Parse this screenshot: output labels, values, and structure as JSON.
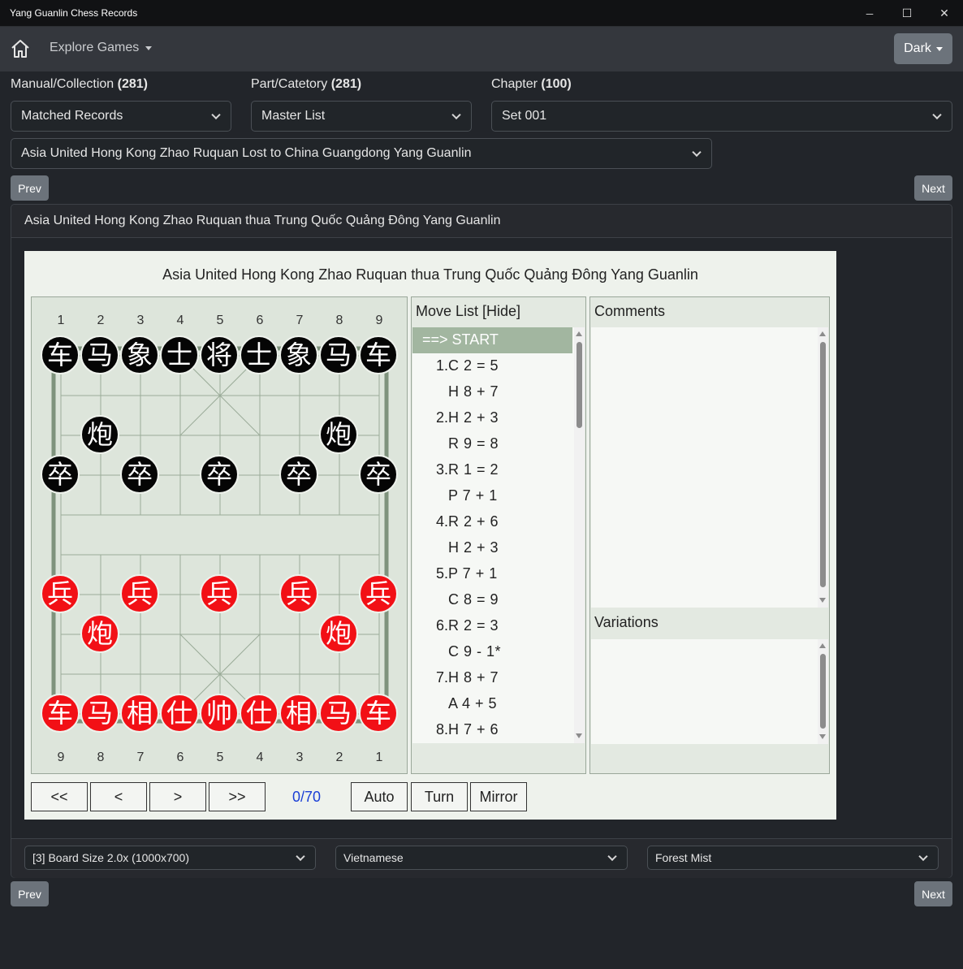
{
  "window": {
    "title": "Yang Guanlin Chess Records",
    "minimize_glyph": "─",
    "maximize_glyph": "☐",
    "close_glyph": "✕"
  },
  "navbar": {
    "home_icon": "home-icon",
    "explore_label": "Explore Games",
    "theme_label": "Dark"
  },
  "filters": {
    "manual_label": "Manual/Collection",
    "manual_count": "(281)",
    "part_label": "Part/Catetory",
    "part_count": "(281)",
    "chapter_label": "Chapter",
    "chapter_count": "(100)",
    "manual_value": "Matched Records",
    "part_value": "Master List",
    "chapter_value": "Set 001",
    "game_value": "Asia United Hong Kong Zhao Ruquan Lost to China Guangdong Yang Guanlin"
  },
  "nav": {
    "prev": "Prev",
    "next": "Next"
  },
  "card": {
    "header": "Asia United Hong Kong Zhao Ruquan thua Trung Quốc Quảng Đông Yang Guanlin"
  },
  "game": {
    "title": "Asia United Hong Kong Zhao Ruquan thua Trung Quốc Quảng Đông Yang Guanlin",
    "top_files": [
      "1",
      "2",
      "3",
      "4",
      "5",
      "6",
      "7",
      "8",
      "9"
    ],
    "bottom_files": [
      "9",
      "8",
      "7",
      "6",
      "5",
      "4",
      "3",
      "2",
      "1"
    ],
    "pieces": [
      {
        "c": 0,
        "r": 0,
        "g": "车",
        "s": "black"
      },
      {
        "c": 1,
        "r": 0,
        "g": "马",
        "s": "black"
      },
      {
        "c": 2,
        "r": 0,
        "g": "象",
        "s": "black"
      },
      {
        "c": 3,
        "r": 0,
        "g": "士",
        "s": "black"
      },
      {
        "c": 4,
        "r": 0,
        "g": "将",
        "s": "black"
      },
      {
        "c": 5,
        "r": 0,
        "g": "士",
        "s": "black"
      },
      {
        "c": 6,
        "r": 0,
        "g": "象",
        "s": "black"
      },
      {
        "c": 7,
        "r": 0,
        "g": "马",
        "s": "black"
      },
      {
        "c": 8,
        "r": 0,
        "g": "车",
        "s": "black"
      },
      {
        "c": 1,
        "r": 2,
        "g": "炮",
        "s": "black"
      },
      {
        "c": 7,
        "r": 2,
        "g": "炮",
        "s": "black"
      },
      {
        "c": 0,
        "r": 3,
        "g": "卒",
        "s": "black"
      },
      {
        "c": 2,
        "r": 3,
        "g": "卒",
        "s": "black"
      },
      {
        "c": 4,
        "r": 3,
        "g": "卒",
        "s": "black"
      },
      {
        "c": 6,
        "r": 3,
        "g": "卒",
        "s": "black"
      },
      {
        "c": 8,
        "r": 3,
        "g": "卒",
        "s": "black"
      },
      {
        "c": 0,
        "r": 6,
        "g": "兵",
        "s": "red"
      },
      {
        "c": 2,
        "r": 6,
        "g": "兵",
        "s": "red"
      },
      {
        "c": 4,
        "r": 6,
        "g": "兵",
        "s": "red"
      },
      {
        "c": 6,
        "r": 6,
        "g": "兵",
        "s": "red"
      },
      {
        "c": 8,
        "r": 6,
        "g": "兵",
        "s": "red"
      },
      {
        "c": 1,
        "r": 7,
        "g": "炮",
        "s": "red"
      },
      {
        "c": 7,
        "r": 7,
        "g": "炮",
        "s": "red"
      },
      {
        "c": 0,
        "r": 9,
        "g": "车",
        "s": "red"
      },
      {
        "c": 1,
        "r": 9,
        "g": "马",
        "s": "red"
      },
      {
        "c": 2,
        "r": 9,
        "g": "相",
        "s": "red"
      },
      {
        "c": 3,
        "r": 9,
        "g": "仕",
        "s": "red"
      },
      {
        "c": 4,
        "r": 9,
        "g": "帅",
        "s": "red"
      },
      {
        "c": 5,
        "r": 9,
        "g": "仕",
        "s": "red"
      },
      {
        "c": 6,
        "r": 9,
        "g": "相",
        "s": "red"
      },
      {
        "c": 7,
        "r": 9,
        "g": "马",
        "s": "red"
      },
      {
        "c": 8,
        "r": 9,
        "g": "车",
        "s": "red"
      }
    ],
    "move_list_label": "Move List [Hide]",
    "moves": [
      {
        "no": "",
        "text": "==> START",
        "active": true
      },
      {
        "no": "1.",
        "text": "C 2 = 5"
      },
      {
        "no": "",
        "text": "H 8 + 7"
      },
      {
        "no": "2.",
        "text": "H 2 + 3"
      },
      {
        "no": "",
        "text": "R 9 = 8"
      },
      {
        "no": "3.",
        "text": "R 1 = 2"
      },
      {
        "no": "",
        "text": "P 7 + 1"
      },
      {
        "no": "4.",
        "text": "R 2 + 6"
      },
      {
        "no": "",
        "text": "H 2 + 3"
      },
      {
        "no": "5.",
        "text": "P 7 + 1"
      },
      {
        "no": "",
        "text": "C 8 = 9"
      },
      {
        "no": "6.",
        "text": "R 2 = 3"
      },
      {
        "no": "",
        "text": "C 9 - 1*"
      },
      {
        "no": "7.",
        "text": "H 8 + 7"
      },
      {
        "no": "",
        "text": "A 4 + 5"
      },
      {
        "no": "8.",
        "text": "H 7 + 6"
      }
    ],
    "comments_label": "Comments",
    "variations_label": "Variations",
    "controls": {
      "first": "<<",
      "prev": "<",
      "next": ">",
      "last": ">>",
      "counter": "0/70",
      "auto": "Auto",
      "turn": "Turn",
      "mirror": "Mirror"
    }
  },
  "footer": {
    "board_size": "[3] Board Size 2.0x (1000x700)",
    "language": "Vietnamese",
    "theme": "Forest Mist"
  }
}
